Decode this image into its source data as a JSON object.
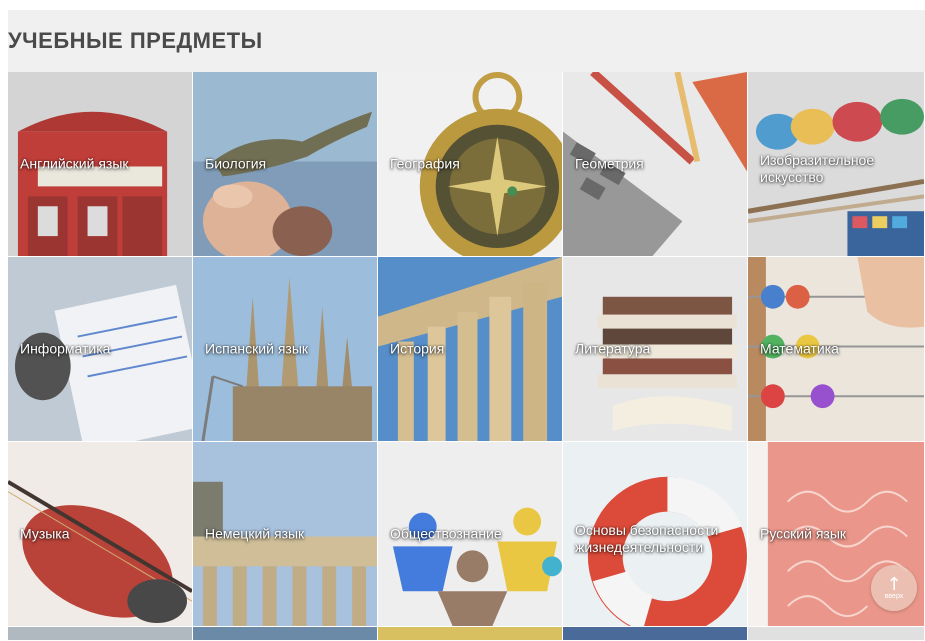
{
  "header": {
    "title": "УЧЕБНЫЕ ПРЕДМЕТЫ"
  },
  "subjects": [
    {
      "label": "Английский язык",
      "icon": "telephone-booth-image"
    },
    {
      "label": "Биология",
      "icon": "lizard-image"
    },
    {
      "label": "География",
      "icon": "compass-image"
    },
    {
      "label": "Геометрия",
      "icon": "calculator-ruler-image"
    },
    {
      "label": "Изобразительное искусство",
      "icon": "paints-image"
    },
    {
      "label": "Информатика",
      "icon": "notebook-mouse-image"
    },
    {
      "label": "Испанский язык",
      "icon": "sagrada-familia-image"
    },
    {
      "label": "История",
      "icon": "columns-image"
    },
    {
      "label": "Литература",
      "icon": "books-image"
    },
    {
      "label": "Математика",
      "icon": "abacus-image"
    },
    {
      "label": "Музыка",
      "icon": "violin-image"
    },
    {
      "label": "Немецкий язык",
      "icon": "brandenburg-gate-image"
    },
    {
      "label": "Обществознание",
      "icon": "figures-image"
    },
    {
      "label": "Основы безопасности жизнедеятельности",
      "icon": "lifebuoy-image"
    },
    {
      "label": "Русский язык",
      "icon": "handwriting-image"
    }
  ],
  "scroll_top": {
    "label": "вверх",
    "icon": "arrow-up-icon"
  },
  "colors": {
    "header_bg": "#f0f0f0",
    "header_text": "#4a4a4a",
    "label_text": "#ffffff"
  }
}
